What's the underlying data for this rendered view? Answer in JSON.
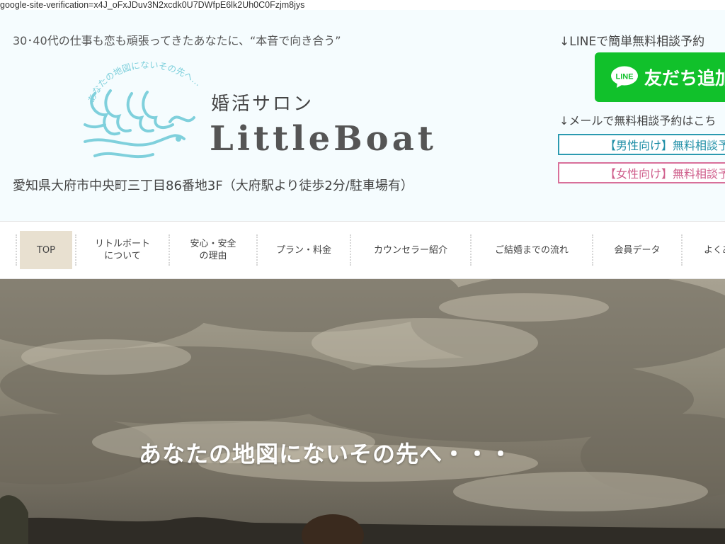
{
  "verification_text": "google-site-verification=x4J_oFxJDuv3N2xcdk0U7DWfpE6lk2Uh0C0Fzjm8jys",
  "header": {
    "tagline": "30･40代の仕事も恋も頑張ってきたあなたに、“本音で向き合う”",
    "logo_arc_text": "あなたの地図にないその先へ…",
    "logo_subtitle": "婚活サロン",
    "logo_title": "LittleBoat",
    "address": "愛知県大府市中央町三丁目86番地3F（大府駅より徒歩2分/駐車場有）",
    "line_note": "↓LINEで簡単無料相談予約",
    "line_icon_text": "LINE",
    "line_button_label": "友だち追加",
    "mail_note": "↓メールで無料相談予約はこち",
    "consult_male": "【男性向け】無料相談予",
    "consult_female": "【女性向け】無料相談予"
  },
  "nav": {
    "items": [
      {
        "label": "TOP"
      },
      {
        "line1": "リトルボート",
        "line2": "について"
      },
      {
        "line1": "安心・安全",
        "line2": "の理由"
      },
      {
        "label": "プラン・料金"
      },
      {
        "label": "カウンセラー紹介"
      },
      {
        "label": "ご結婚までの流れ"
      },
      {
        "label": "会員データ"
      },
      {
        "label": "よくあ"
      }
    ]
  },
  "hero": {
    "headline": "あなたの地図にないその先へ・・・"
  },
  "colors": {
    "header_bg": "#f5fcfe",
    "logo_accent": "#7fd0dc",
    "line_green": "#11c12b",
    "male_border": "#2b9ab0",
    "female_border": "#d8709a",
    "nav_active_bg": "#e8e0d0"
  }
}
